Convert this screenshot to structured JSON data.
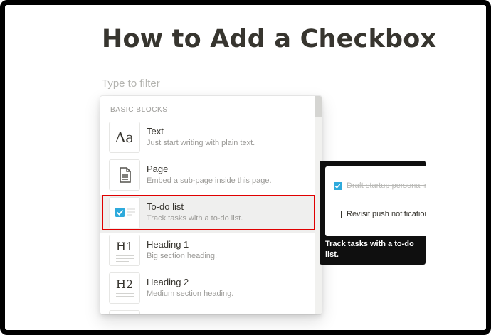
{
  "page": {
    "title": "How to Add a Checkbox",
    "filter_placeholder": "Type to filter"
  },
  "menu": {
    "section_label": "BASIC BLOCKS",
    "items": [
      {
        "name": "Text",
        "description": "Just start writing with plain text.",
        "icon": "text-aa-icon",
        "thumb_label": "Aa"
      },
      {
        "name": "Page",
        "description": "Embed a sub-page inside this page.",
        "icon": "page-icon"
      },
      {
        "name": "To-do list",
        "description": "Track tasks with a to-do list.",
        "icon": "todo-checkbox-icon",
        "selected": true
      },
      {
        "name": "Heading 1",
        "description": "Big section heading.",
        "icon": "heading1-icon",
        "thumb_label": "H1"
      },
      {
        "name": "Heading 2",
        "description": "Medium section heading.",
        "icon": "heading2-icon",
        "thumb_label": "H2"
      }
    ]
  },
  "preview": {
    "rows": [
      {
        "text": "Draft startup persona interview playbook",
        "checked": true
      },
      {
        "text": "Revisit push notifications strategy",
        "checked": false
      }
    ],
    "caption": "Track tasks with a to-do list."
  },
  "colors": {
    "highlight_border": "#e00000",
    "checkbox_accent": "#2eaadc",
    "tooltip_bg": "#0f0f0f",
    "selected_row_bg": "#efefee"
  }
}
